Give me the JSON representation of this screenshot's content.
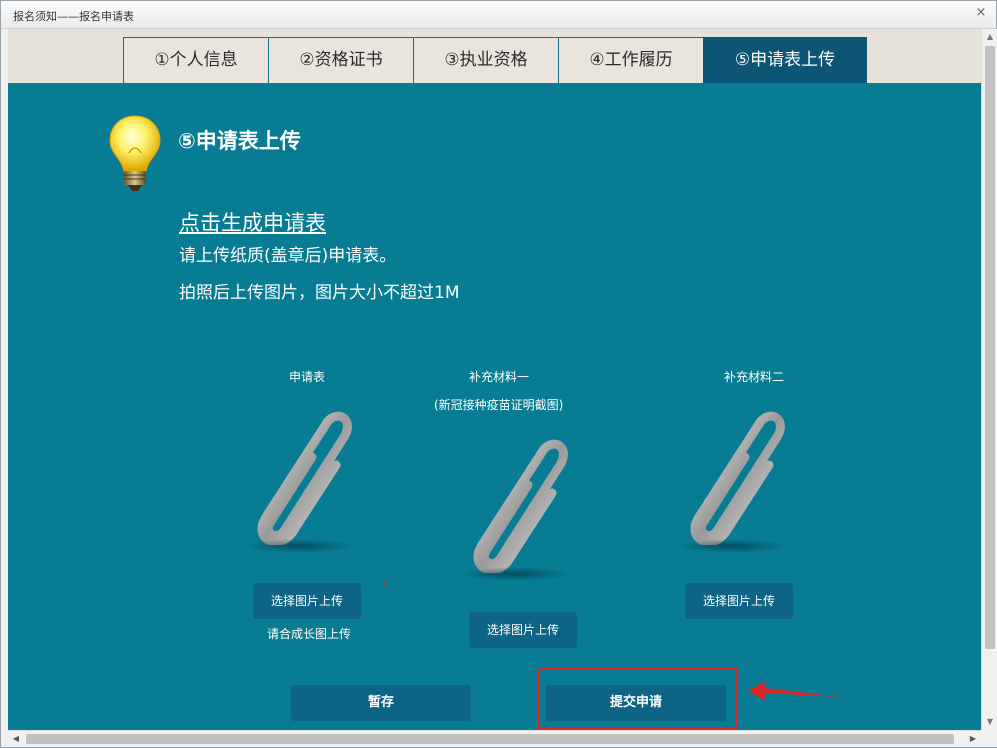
{
  "window": {
    "title": "报名须知——报名申请表",
    "close_glyph": "×"
  },
  "tabs": [
    {
      "label": "①个人信息"
    },
    {
      "label": "②资格证书"
    },
    {
      "label": "③执业资格"
    },
    {
      "label": "④工作履历"
    },
    {
      "label": "⑤申请表上传",
      "active": true
    }
  ],
  "section": {
    "heading": "⑤申请表上传",
    "generate_link": "点击生成申请表",
    "note1": "请上传纸质(盖章后)申请表。",
    "note2": "拍照后上传图片，图片大小不超过1M"
  },
  "uploads": [
    {
      "label": "申请表",
      "sublabel": "",
      "button": "选择图片上传",
      "hint": "请合成长图上传",
      "icon": "paperclip-icon"
    },
    {
      "label": "补充材料一",
      "sublabel": "(新冠接种疫苗证明截图)",
      "button": "选择图片上传",
      "hint": "",
      "icon": "paperclip-icon"
    },
    {
      "label": "补充材料二",
      "sublabel": "",
      "button": "选择图片上传",
      "hint": "",
      "icon": "paperclip-icon"
    }
  ],
  "required_marker": "*",
  "actions": {
    "save_label": "暂存",
    "submit_label": "提交申请"
  },
  "colors": {
    "content_bg": "#077c93",
    "active_tab": "#0d5574",
    "button_bg": "#0d6484",
    "highlight": "#e32424"
  },
  "icons": [
    "lightbulb-icon",
    "paperclip-icon",
    "close-icon",
    "arrow-icon"
  ]
}
